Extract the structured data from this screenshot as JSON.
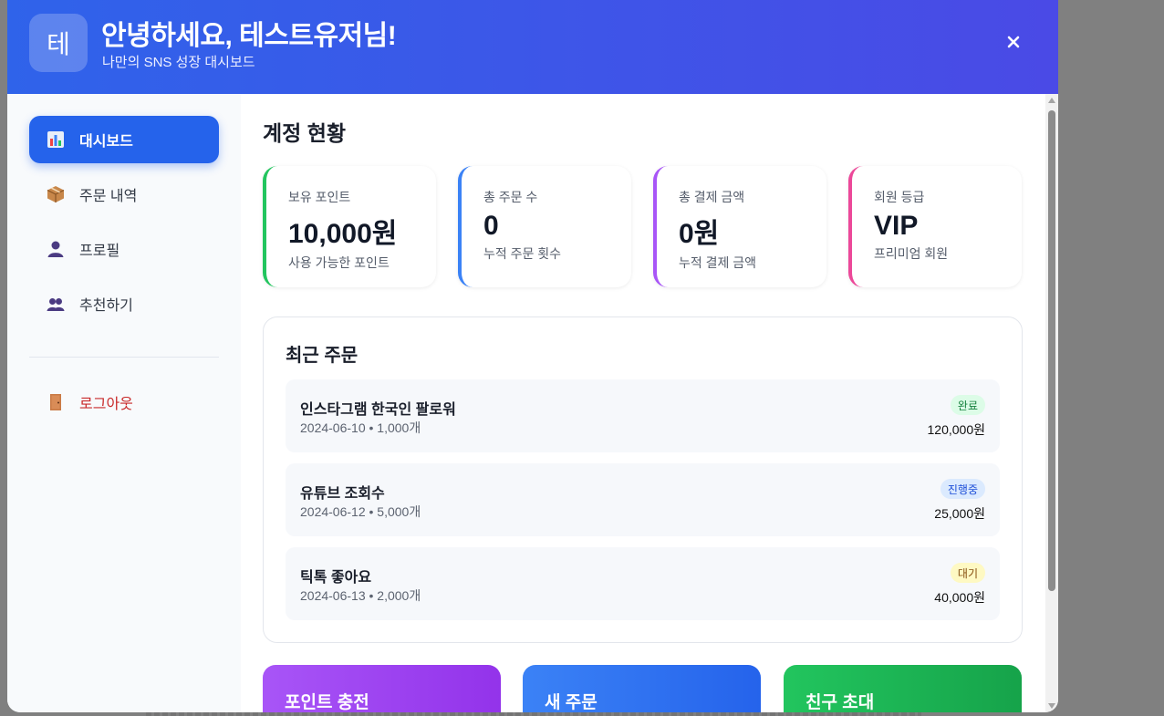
{
  "header": {
    "avatar_letter": "테",
    "greeting": "안녕하세요, 테스트유저님!",
    "subtitle": "나만의 SNS 성장 대시보드"
  },
  "sidebar": {
    "items": [
      {
        "label": "대시보드",
        "icon": "bar-chart-icon",
        "active": true
      },
      {
        "label": "주문 내역",
        "icon": "package-icon"
      },
      {
        "label": "프로필",
        "icon": "user-icon"
      },
      {
        "label": "추천하기",
        "icon": "users-icon"
      }
    ],
    "logout_label": "로그아웃",
    "logout_icon": "door-icon"
  },
  "main": {
    "title": "계정 현황",
    "stats": [
      {
        "label": "보유 포인트",
        "value": "10,000원",
        "desc": "사용 가능한 포인트",
        "color": "#22c55e"
      },
      {
        "label": "총 주문 수",
        "value": "0",
        "desc": "누적 주문 횟수",
        "color": "#3b82f6"
      },
      {
        "label": "총 결제 금액",
        "value": "0원",
        "desc": "누적 결제 금액",
        "color": "#a855f7"
      },
      {
        "label": "회원 등급",
        "value": "VIP",
        "desc": "프리미엄 회원",
        "color": "#ec4899"
      }
    ],
    "recent_orders": {
      "title": "최근 주문",
      "items": [
        {
          "name": "인스타그램 한국인 팔로워",
          "meta": "2024-06-10 • 1,000개",
          "status": "완료",
          "status_bg": "#dcfce7",
          "status_color": "#15803d",
          "price": "120,000원"
        },
        {
          "name": "유튜브 조회수",
          "meta": "2024-06-12 • 5,000개",
          "status": "진행중",
          "status_bg": "#dbeafe",
          "status_color": "#1d4ed8",
          "price": "25,000원"
        },
        {
          "name": "틱톡 좋아요",
          "meta": "2024-06-13 • 2,000개",
          "status": "대기",
          "status_bg": "#fef9c3",
          "status_color": "#854d0e",
          "price": "40,000원"
        }
      ]
    },
    "actions": [
      {
        "label": "포인트 충전",
        "from": "#a855f7",
        "to": "#9333ea"
      },
      {
        "label": "새 주문",
        "from": "#3b82f6",
        "to": "#2563eb"
      },
      {
        "label": "친구 초대",
        "from": "#22c55e",
        "to": "#16a34a"
      }
    ]
  }
}
